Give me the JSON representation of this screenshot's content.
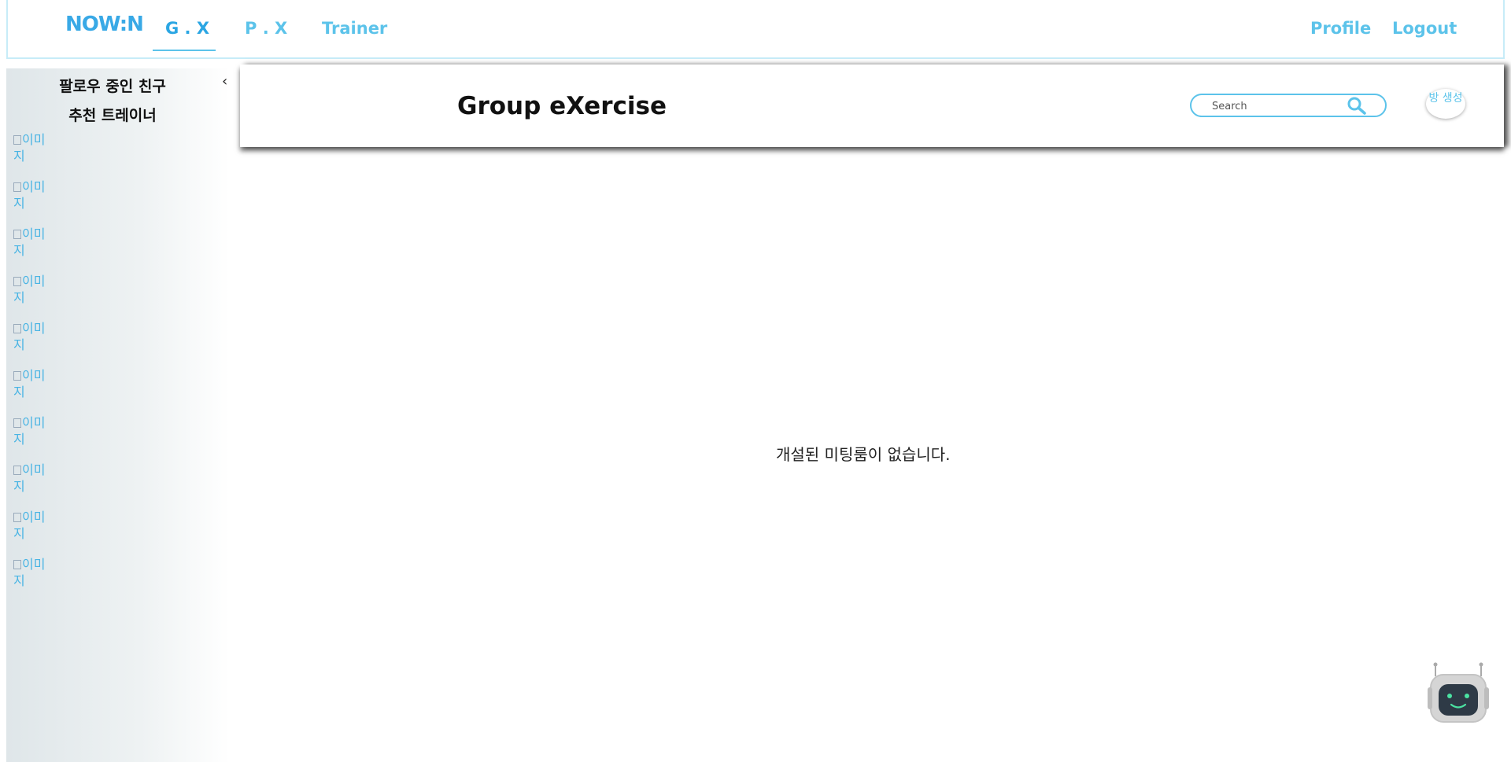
{
  "nav": {
    "logo": "NOW:N",
    "links": {
      "gx": "G . X",
      "px": "P . X",
      "trainer": "Trainer",
      "profile": "Profile",
      "logout": "Logout"
    },
    "active_tab": "G . X"
  },
  "sidebar": {
    "following_title": "팔로우 중인 친구",
    "recommended_title": "추천 트레이너",
    "collapse_icon": "chevron-left-icon",
    "image_alt": "이미지",
    "image_count": 10
  },
  "header": {
    "title": "Group eXercise",
    "search_placeholder": "Search",
    "create_room_label": "방 생성"
  },
  "main": {
    "empty_message": "개설된 미팅룸이 없습니다."
  },
  "colors": {
    "accent": "#5cc3ea",
    "logo": "#39a9e6",
    "text": "#111111"
  },
  "chatbot": {
    "icon": "robot-icon"
  }
}
